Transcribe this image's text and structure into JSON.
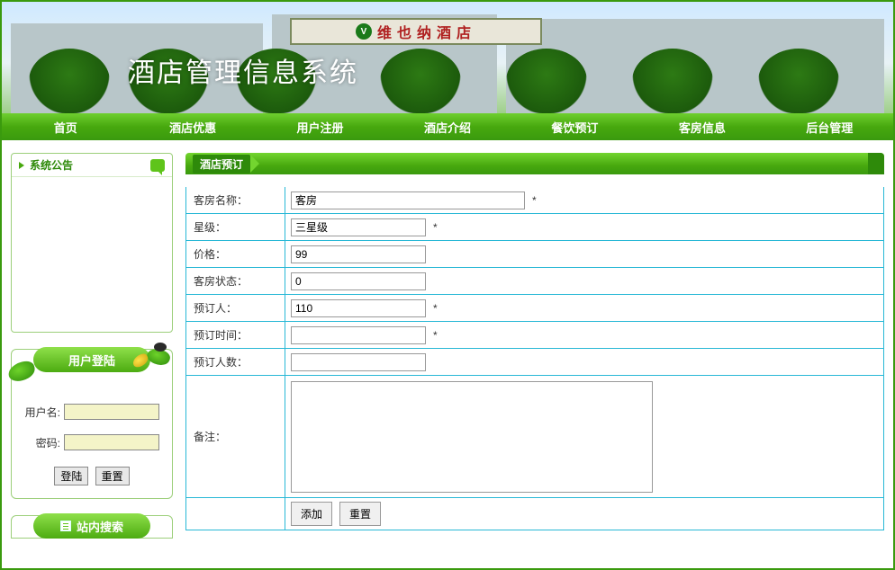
{
  "banner": {
    "sign_text": "维也纳酒店",
    "system_title": "酒店管理信息系统"
  },
  "nav": [
    "首页",
    "酒店优惠",
    "用户注册",
    "酒店介绍",
    "餐饮预订",
    "客房信息",
    "后台管理"
  ],
  "sidebar": {
    "announce_title": "系统公告",
    "login": {
      "title": "用户登陆",
      "user_label": "用户名:",
      "pass_label": "密码:",
      "login_btn": "登陆",
      "reset_btn": "重置"
    },
    "search_title": "站内搜索"
  },
  "main": {
    "title": "酒店预订",
    "required_mark": "*",
    "fields": {
      "room_name": {
        "label": "客房名称：",
        "value": "客房",
        "required": true
      },
      "star": {
        "label": "星级：",
        "value": "三星级",
        "required": true
      },
      "price": {
        "label": "价格：",
        "value": "99",
        "required": false
      },
      "status": {
        "label": "客房状态：",
        "value": "0",
        "required": false
      },
      "booker": {
        "label": "预订人：",
        "value": "110",
        "required": true
      },
      "book_time": {
        "label": "预订时间：",
        "value": "",
        "required": true
      },
      "book_count": {
        "label": "预订人数：",
        "value": "",
        "required": false
      },
      "remark": {
        "label": "备注：",
        "value": ""
      }
    },
    "add_btn": "添加",
    "reset_btn": "重置"
  }
}
